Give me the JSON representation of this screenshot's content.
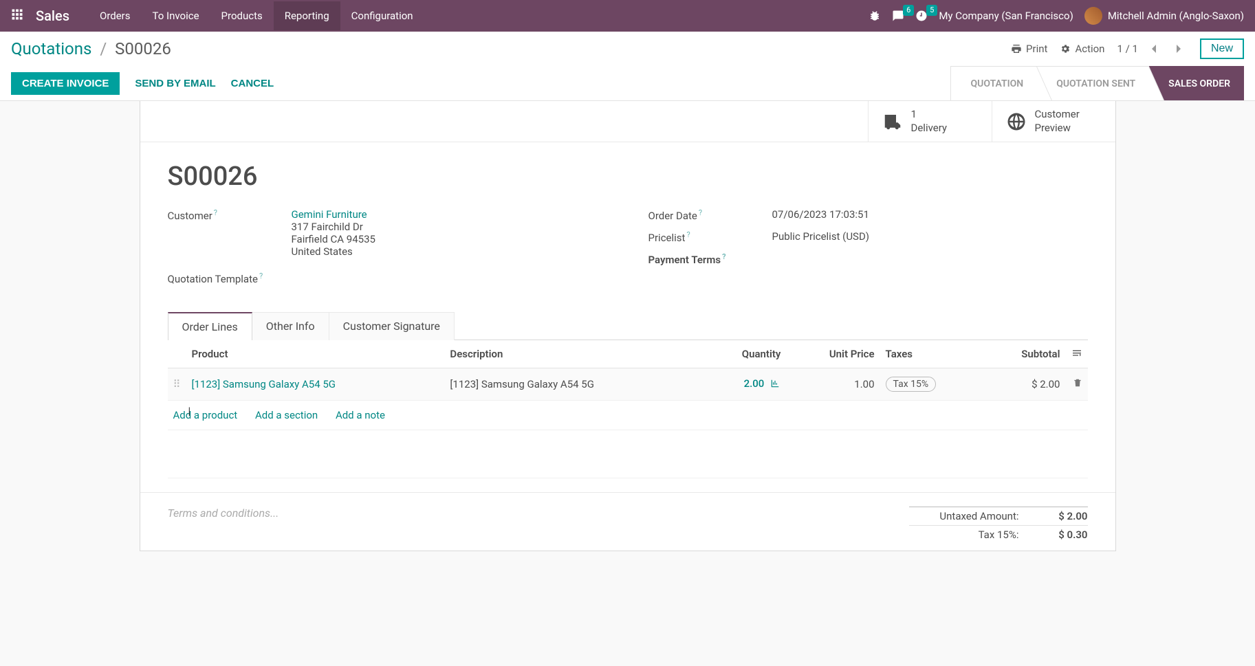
{
  "topnav": {
    "brand": "Sales",
    "menu": [
      "Orders",
      "To Invoice",
      "Products",
      "Reporting",
      "Configuration"
    ],
    "active_index": 3,
    "messages_badge": "6",
    "activities_badge": "5",
    "company": "My Company (San Francisco)",
    "user": "Mitchell Admin (Anglo-Saxon)"
  },
  "breadcrumb": {
    "root": "Quotations",
    "current": "S00026"
  },
  "cp": {
    "print": "Print",
    "action": "Action",
    "pager_current": "1",
    "pager_total": "1",
    "new": "New"
  },
  "buttons": {
    "create_invoice": "CREATE INVOICE",
    "send_email": "SEND BY EMAIL",
    "cancel": "CANCEL"
  },
  "status": {
    "quotation": "QUOTATION",
    "quotation_sent": "QUOTATION SENT",
    "sales_order": "SALES ORDER"
  },
  "stat": {
    "delivery_count": "1",
    "delivery_label": "Delivery",
    "preview_line1": "Customer",
    "preview_line2": "Preview"
  },
  "order": {
    "name": "S00026",
    "labels": {
      "customer": "Customer",
      "quotation_template": "Quotation Template",
      "order_date": "Order Date",
      "pricelist": "Pricelist",
      "payment_terms": "Payment Terms"
    },
    "customer": "Gemini Furniture",
    "address": [
      "317 Fairchild Dr",
      "Fairfield CA 94535",
      "United States"
    ],
    "order_date": "07/06/2023 17:03:51",
    "pricelist": "Public Pricelist (USD)"
  },
  "tabs": [
    "Order Lines",
    "Other Info",
    "Customer Signature"
  ],
  "table": {
    "headers": {
      "product": "Product",
      "description": "Description",
      "quantity": "Quantity",
      "unit_price": "Unit Price",
      "taxes": "Taxes",
      "subtotal": "Subtotal"
    },
    "row": {
      "product": "[1123] Samsung Galaxy A54 5G",
      "description": "[1123] Samsung Galaxy A54 5G",
      "quantity": "2.00",
      "unit_price": "1.00",
      "tax": "Tax 15%",
      "subtotal": "$ 2.00"
    },
    "add": {
      "product": "Add a product",
      "section": "Add a section",
      "note": "Add a note"
    }
  },
  "footer": {
    "terms_placeholder": "Terms and conditions...",
    "untaxed_label": "Untaxed Amount:",
    "untaxed_value": "$ 2.00",
    "tax_label": "Tax 15%:",
    "tax_value": "$ 0.30"
  }
}
